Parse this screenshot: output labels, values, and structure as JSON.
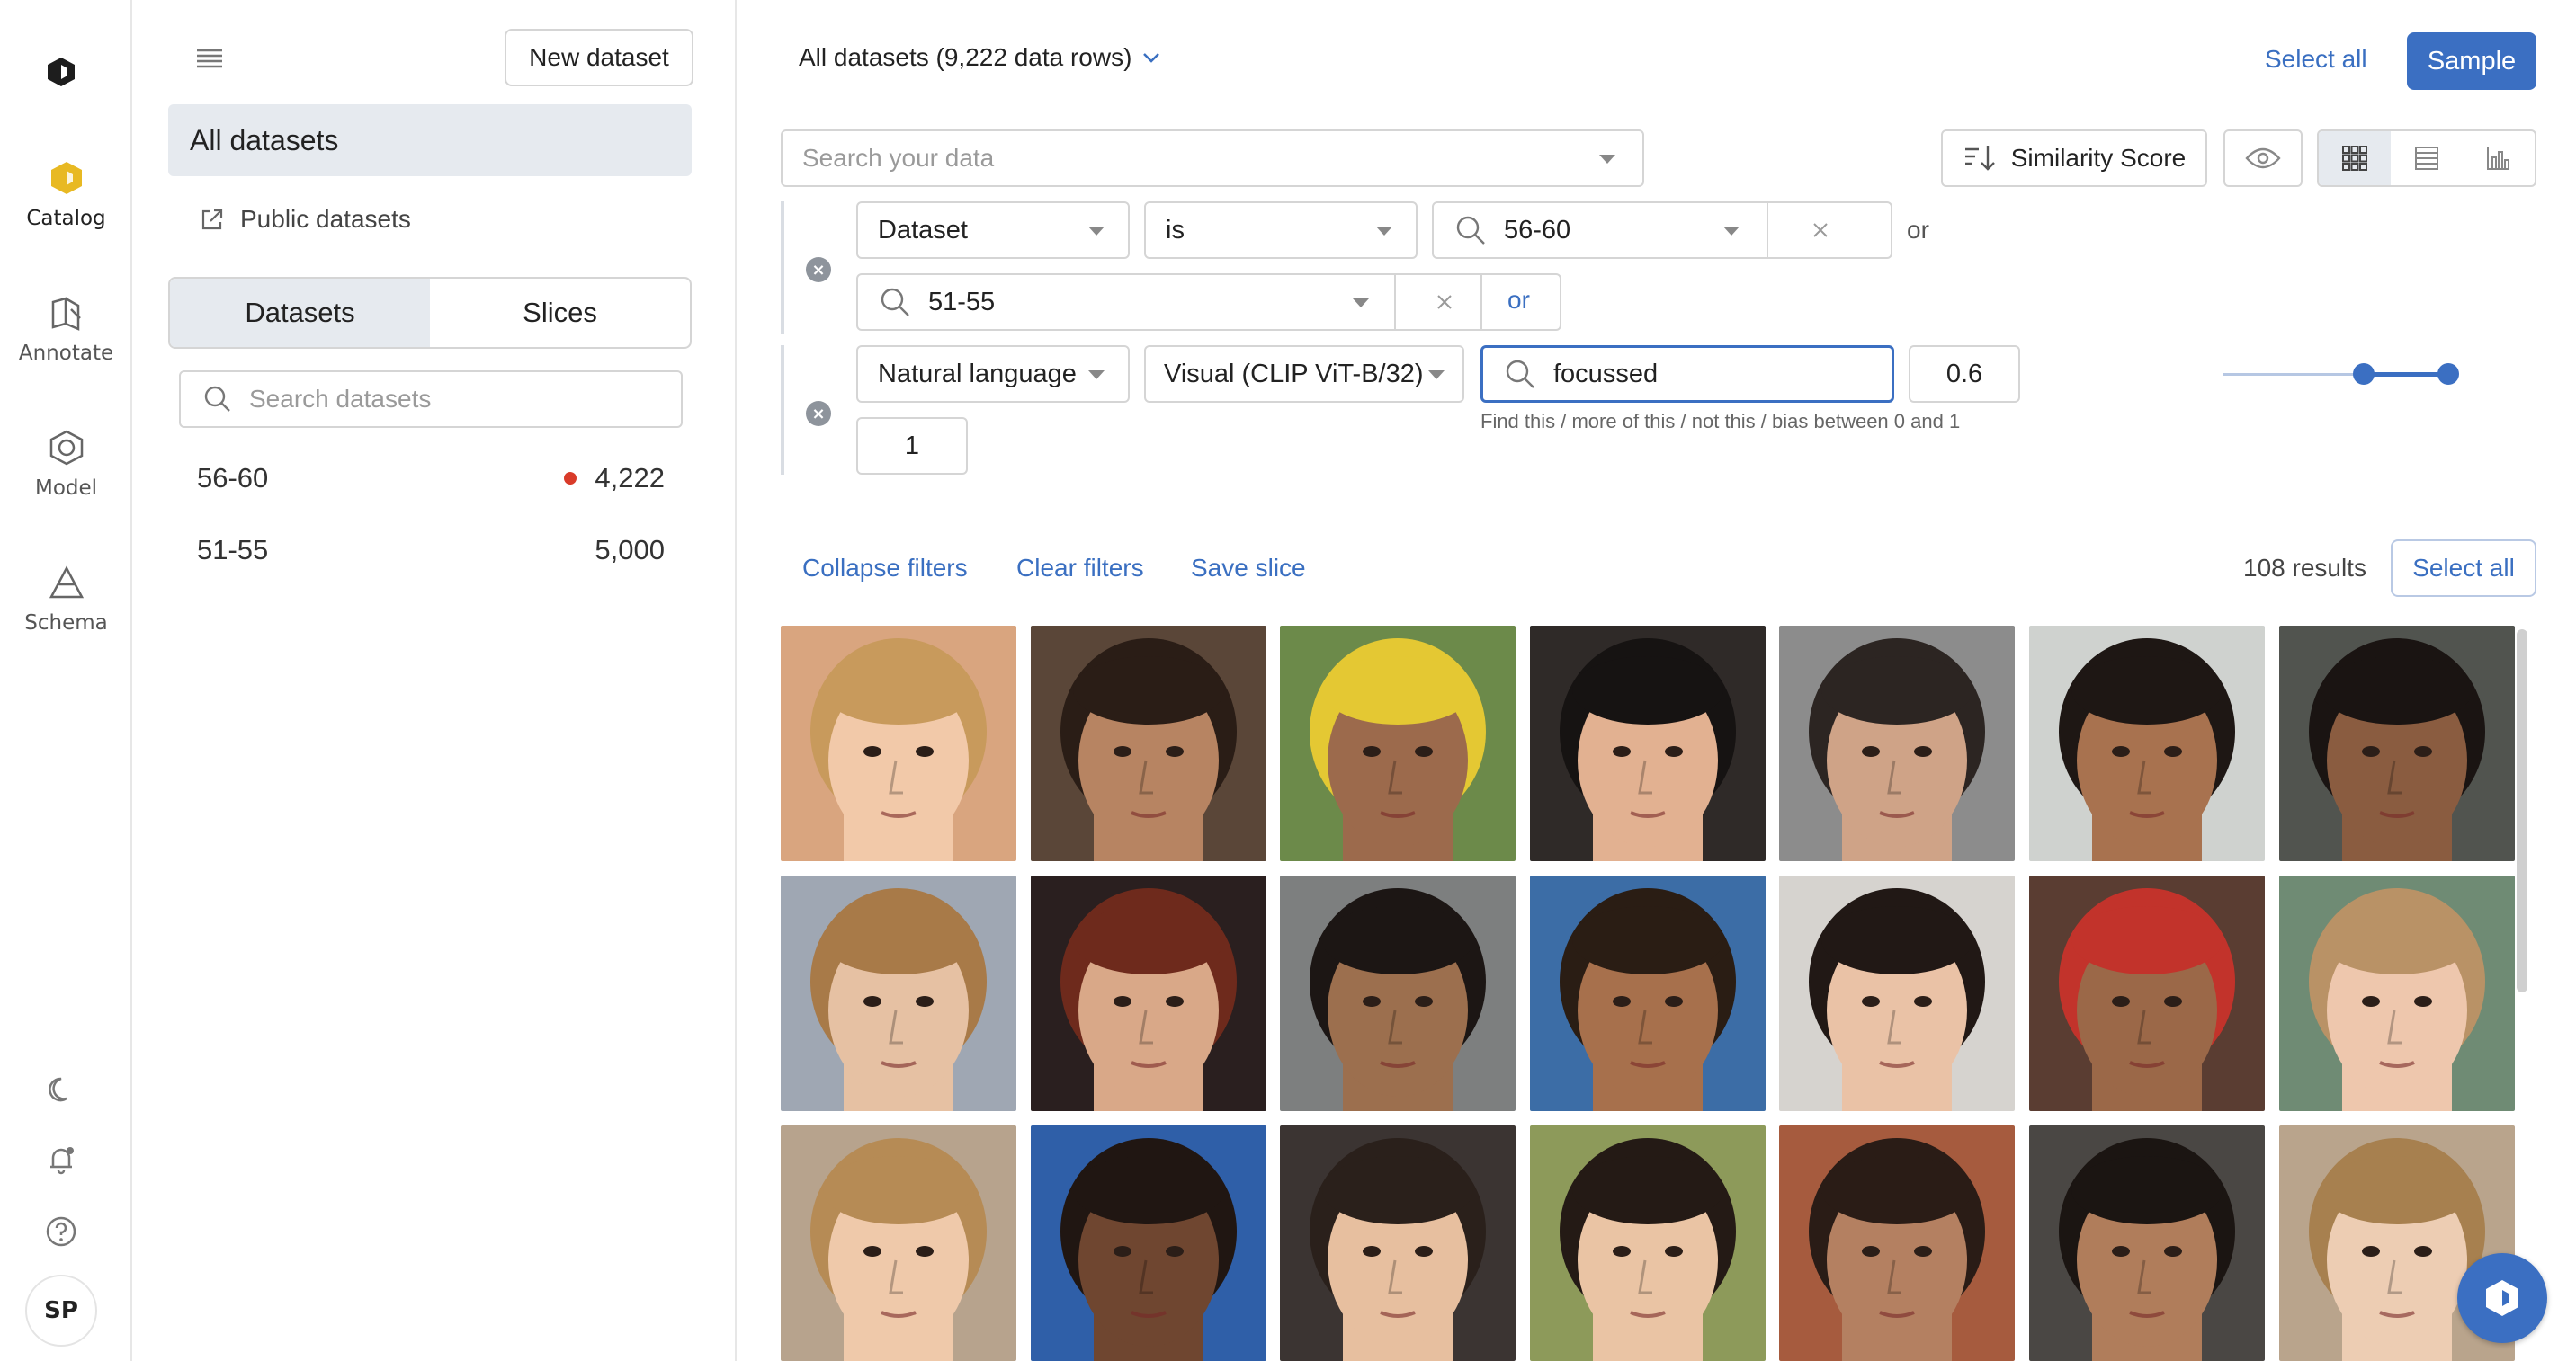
{
  "rail": {
    "items": [
      {
        "label": "Catalog",
        "icon": "catalog-icon",
        "active": true
      },
      {
        "label": "Annotate",
        "icon": "annotate-icon"
      },
      {
        "label": "Model",
        "icon": "model-icon"
      },
      {
        "label": "Schema",
        "icon": "schema-icon"
      }
    ],
    "bottom_icons": [
      "moon-icon",
      "bell-icon",
      "help-icon"
    ],
    "avatar": "SP",
    "accent": "#e8b923"
  },
  "panel": {
    "new_dataset": "New dataset",
    "all_datasets": "All datasets",
    "public_datasets": "Public datasets",
    "tabs": [
      "Datasets",
      "Slices"
    ],
    "active_tab": "Datasets",
    "search_placeholder": "Search datasets",
    "datasets": [
      {
        "name": "56-60",
        "count": "4,222",
        "dot": true
      },
      {
        "name": "51-55",
        "count": "5,000",
        "dot": false
      }
    ]
  },
  "main": {
    "title": "All datasets (9,222 data rows)",
    "select_all": "Select all",
    "sample": "Sample",
    "search_placeholder": "Search your data",
    "similarity": "Similarity Score",
    "filters": {
      "dataset_field": "Dataset",
      "dataset_op": "is",
      "value1": "56-60",
      "value2": "51-55",
      "or_label": "or",
      "or_button": "or",
      "nl_field": "Natural language",
      "model": "Visual (CLIP ViT-B/32)",
      "query": "focussed",
      "threshold": "0.6",
      "weight": "1",
      "hint": "Find this / more of this / not this / bias between 0 and 1",
      "range": [
        0.6,
        1
      ]
    },
    "collapse_filters": "Collapse filters",
    "clear_filters": "Clear filters",
    "save_slice": "Save slice",
    "results": "108 results",
    "select_all_results": "Select all",
    "accent": "#3b6fc2"
  },
  "thumbnails": [
    {
      "bg": "#d9a57f",
      "skin": "#f2c9a9",
      "hair": "#c89a5c"
    },
    {
      "bg": "#5a4638",
      "skin": "#b78462",
      "hair": "#2a1d16"
    },
    {
      "bg": "#6c8a4a",
      "skin": "#9c6a4c",
      "hair": "#e4c833"
    },
    {
      "bg": "#2f2a28",
      "skin": "#e2b191",
      "hair": "#161312"
    },
    {
      "bg": "#8c8c8c",
      "skin": "#cfa387",
      "hair": "#2c2522"
    },
    {
      "bg": "#cfd2cf",
      "skin": "#a8724f",
      "hair": "#1e1714"
    },
    {
      "bg": "#51544f",
      "skin": "#8a5c40",
      "hair": "#1a1412"
    },
    {
      "bg": "#9fa7b3",
      "skin": "#e6c1a3",
      "hair": "#a87a48"
    },
    {
      "bg": "#2a1f1f",
      "skin": "#d9a888",
      "hair": "#6e2a1c"
    },
    {
      "bg": "#7d7f7f",
      "skin": "#9c6f4e",
      "hair": "#1c1614"
    },
    {
      "bg": "#3c6da6",
      "skin": "#a7704c",
      "hair": "#2a1d14"
    },
    {
      "bg": "#d6d3cf",
      "skin": "#eac2a6",
      "hair": "#211815"
    },
    {
      "bg": "#5a3d32",
      "skin": "#9b6848",
      "hair": "#c2332b"
    },
    {
      "bg": "#6f8b74",
      "skin": "#eec7ad",
      "hair": "#b99266"
    },
    {
      "bg": "#b7a38d",
      "skin": "#efc9aa",
      "hair": "#b68b55"
    },
    {
      "bg": "#2f5fa8",
      "skin": "#6f4630",
      "hair": "#201612"
    },
    {
      "bg": "#3b3432",
      "skin": "#e7bf9f",
      "hair": "#2a201b"
    },
    {
      "bg": "#8d9a5a",
      "skin": "#eac4a4",
      "hair": "#241a15"
    },
    {
      "bg": "#a65b3e",
      "skin": "#b48061",
      "hair": "#2a1c16"
    },
    {
      "bg": "#4a4744",
      "skin": "#b07d5b",
      "hair": "#1b1512"
    },
    {
      "bg": "#b9a48c",
      "skin": "#edcdb3",
      "hair": "#a7804f"
    }
  ]
}
